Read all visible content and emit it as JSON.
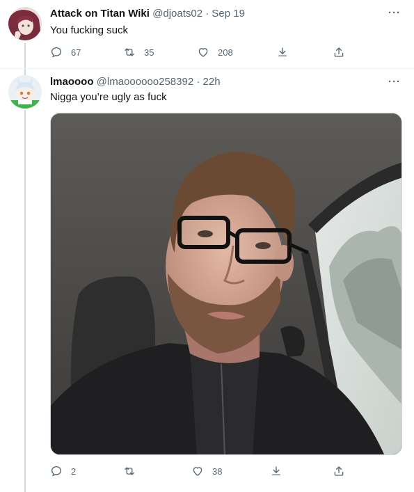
{
  "tweets": [
    {
      "display_name": "Attack on Titan Wiki",
      "handle": "@djoats02",
      "separator": "·",
      "time": "Sep 19",
      "text": "You fucking suck",
      "replies": "67",
      "retweets": "35",
      "likes": "208"
    },
    {
      "display_name": "lmaoooo",
      "handle": "@lmaoooooo258392",
      "separator": "·",
      "time": "22h",
      "text": "Nigga you’re ugly as fuck",
      "replies": "2",
      "retweets": "",
      "likes": "38"
    }
  ],
  "icons": {
    "reply": "reply-icon",
    "retweet": "retweet-icon",
    "like": "heart-icon",
    "download": "download-icon",
    "share": "share-icon",
    "more": "more-icon"
  },
  "colors": {
    "muted": "#536471",
    "text": "#0f1419",
    "divider": "#eff3f4"
  }
}
